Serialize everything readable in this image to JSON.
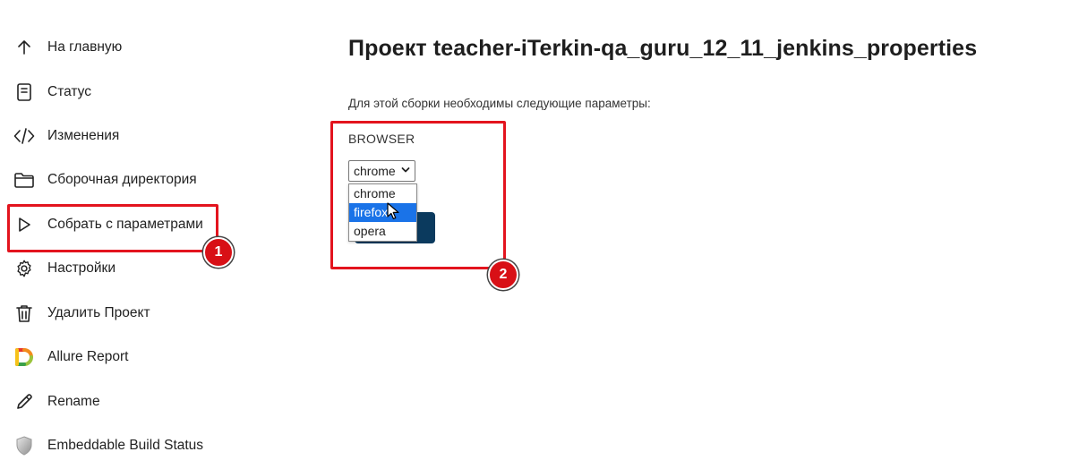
{
  "sidebar": {
    "items": [
      {
        "label": "На главную",
        "icon": "arrow-up-icon"
      },
      {
        "label": "Статус",
        "icon": "document-icon"
      },
      {
        "label": "Изменения",
        "icon": "code-icon"
      },
      {
        "label": "Сборочная директория",
        "icon": "folder-icon"
      },
      {
        "label": "Собрать с параметрами",
        "icon": "play-icon"
      },
      {
        "label": "Настройки",
        "icon": "gear-icon"
      },
      {
        "label": "Удалить Проект",
        "icon": "trash-icon"
      },
      {
        "label": "Allure Report",
        "icon": "allure-icon"
      },
      {
        "label": "Rename",
        "icon": "pencil-icon"
      },
      {
        "label": "Embeddable Build Status",
        "icon": "shield-icon"
      }
    ]
  },
  "main": {
    "title": "Проект teacher-iTerkin-qa_guru_12_11_jenkins_properties",
    "params_description": "Для этой сборки необходимы следующие параметры:",
    "param": {
      "name": "BROWSER",
      "selected": "chrome",
      "options": [
        "chrome",
        "firefox",
        "opera"
      ],
      "highlighted_option": "firefox"
    }
  },
  "annotations": {
    "badge1": "1",
    "badge2": "2",
    "color": "#e3141e"
  }
}
